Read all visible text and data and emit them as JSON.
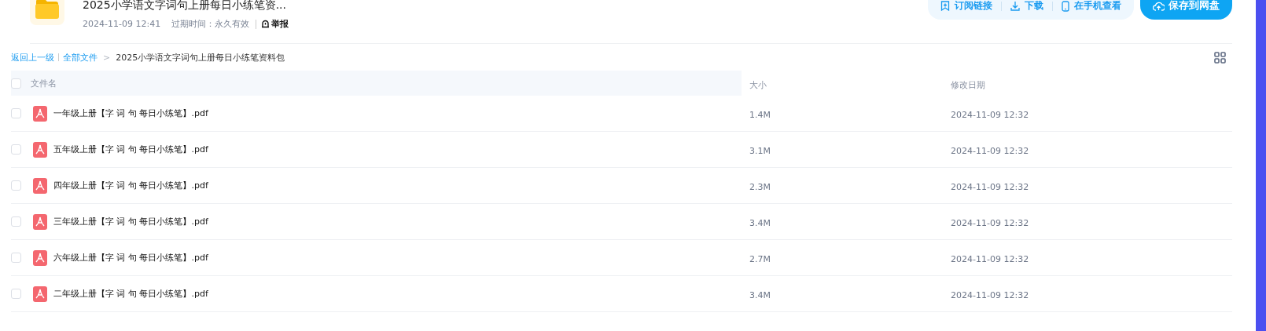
{
  "header": {
    "title": "2025小学语文字词句上册每日小练笔资...",
    "date": "2024-11-09 12:41",
    "expiry": "过期时间：永久有效",
    "report": "举报"
  },
  "actions": [
    {
      "label": "订阅链接",
      "kind": "subscribe"
    },
    {
      "label": "下载",
      "kind": "download"
    },
    {
      "label": "在手机查看",
      "kind": "phone"
    }
  ],
  "save_button": {
    "label": "保存到网盘"
  },
  "breadcrumb": {
    "back": "返回上一级",
    "root": "全部文件",
    "separator": ">",
    "current": "2025小学语文字词句上册每日小练笔资料包"
  },
  "table": {
    "columns": [
      "文件名",
      "大小",
      "修改日期"
    ],
    "all_checked": false,
    "rows": [
      {
        "name": "一年级上册【字 词 句 每日小练笔】.pdf",
        "size": "1.4M",
        "date": "2024-11-09 12:32",
        "checked": false
      },
      {
        "name": "五年级上册【字 词 句 每日小练笔】.pdf",
        "size": "3.1M",
        "date": "2024-11-09 12:32",
        "checked": false
      },
      {
        "name": "四年级上册【字 词 句 每日小练笔】.pdf",
        "size": "2.3M",
        "date": "2024-11-09 12:32",
        "checked": false
      },
      {
        "name": "三年级上册【字 词 句 每日小练笔】.pdf",
        "size": "3.4M",
        "date": "2024-11-09 12:32",
        "checked": false
      },
      {
        "name": "六年级上册【字 词 句 每日小练笔】.pdf",
        "size": "2.7M",
        "date": "2024-11-09 12:32",
        "checked": false
      },
      {
        "name": "二年级上册【字 词 句 每日小练笔】.pdf",
        "size": "3.4M",
        "date": "2024-11-09 12:32",
        "checked": false
      }
    ]
  }
}
